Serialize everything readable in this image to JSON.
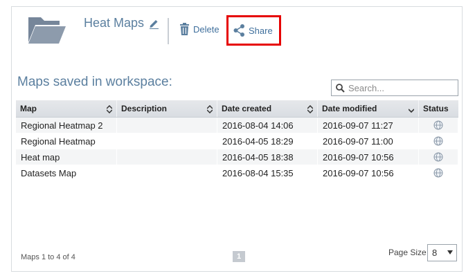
{
  "header": {
    "title": "Heat Maps",
    "folder_icon": "folder-icon",
    "edit_icon": "pencil-icon",
    "delete_label": "Delete",
    "share_label": "Share"
  },
  "section": {
    "title": "Maps saved in workspace:"
  },
  "search": {
    "placeholder": "Search...",
    "value": ""
  },
  "table": {
    "columns": [
      "Map",
      "Description",
      "Date created",
      "Date modified",
      "Status"
    ],
    "rows": [
      {
        "map": "Regional Heatmap 2",
        "description": "",
        "created": "2016-08-04 14:06",
        "modified": "2016-09-07 11:27",
        "status_icon": "globe-icon"
      },
      {
        "map": "Regional Heatmap",
        "description": "",
        "created": "2016-04-05 18:29",
        "modified": "2016-09-07 11:00",
        "status_icon": "globe-icon"
      },
      {
        "map": "Heat map",
        "description": "",
        "created": "2016-04-05 18:38",
        "modified": "2016-09-07 10:56",
        "status_icon": "globe-icon"
      },
      {
        "map": "Datasets Map",
        "description": "",
        "created": "2016-08-04 15:35",
        "modified": "2016-09-07 10:56",
        "status_icon": "globe-icon"
      }
    ]
  },
  "footer": {
    "summary": "Maps 1 to 4 of 4",
    "current_page": "1",
    "page_size_label": "Page Size",
    "page_size_value": "8"
  },
  "colors": {
    "accent": "#5b7f9f",
    "link": "#3f6f9c",
    "highlight": "#e60000"
  }
}
